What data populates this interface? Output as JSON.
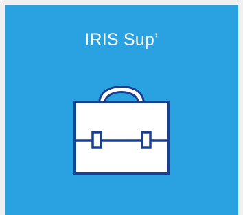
{
  "tile": {
    "title": "IRIS Sup’",
    "icon": "briefcase-icon",
    "colors": {
      "background": "#2aa1e0",
      "icon_fill": "#ffffff",
      "icon_stroke": "#1b3f8f",
      "title_text": "#ffffff"
    }
  }
}
